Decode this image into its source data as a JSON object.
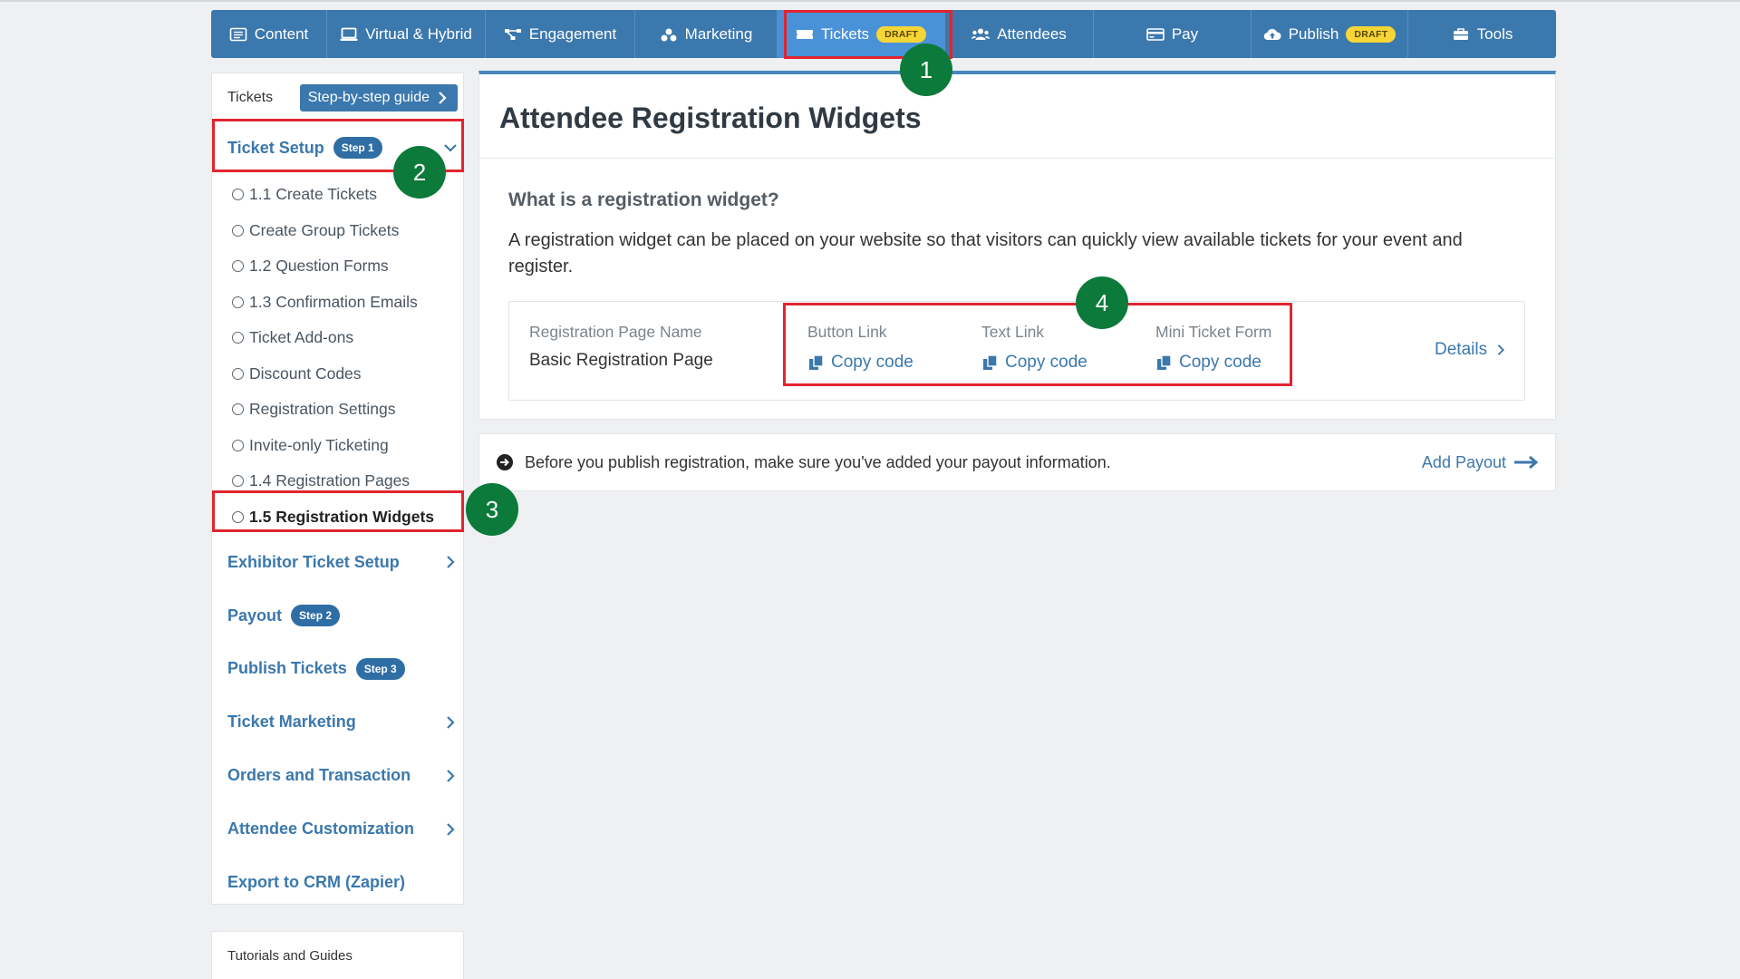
{
  "nav": {
    "items": [
      {
        "label": "Content",
        "icon": "list-icon"
      },
      {
        "label": "Virtual & Hybrid",
        "icon": "monitor-icon"
      },
      {
        "label": "Engagement",
        "icon": "network-icon"
      },
      {
        "label": "Marketing",
        "icon": "share-icon"
      },
      {
        "label": "Tickets",
        "icon": "ticket-icon",
        "badge": "DRAFT",
        "active": true
      },
      {
        "label": "Attendees",
        "icon": "users-icon"
      },
      {
        "label": "Pay",
        "icon": "credit-card-icon"
      },
      {
        "label": "Publish",
        "icon": "cloud-upload-icon",
        "badge": "DRAFT"
      },
      {
        "label": "Tools",
        "icon": "toolbox-icon"
      }
    ]
  },
  "sidebar": {
    "title": "Tickets",
    "guide_label": "Step-by-step guide",
    "ticket_setup": {
      "label": "Ticket Setup",
      "badge": "Step 1",
      "expanded": true
    },
    "sub_items": [
      "1.1 Create Tickets",
      "Create Group Tickets",
      "1.2 Question Forms",
      "1.3 Confirmation Emails",
      "Ticket Add-ons",
      "Discount Codes",
      "Registration Settings",
      "Invite-only Ticketing",
      "1.4 Registration Pages",
      "1.5 Registration Widgets"
    ],
    "current_sub_item": "1.5 Registration Widgets",
    "sections": [
      {
        "label": "Exhibitor Ticket Setup",
        "chevron": true
      },
      {
        "label": "Payout",
        "badge": "Step 2"
      },
      {
        "label": "Publish Tickets",
        "badge": "Step 3"
      },
      {
        "label": "Ticket Marketing",
        "chevron": true
      },
      {
        "label": "Orders and Transaction",
        "chevron": true
      },
      {
        "label": "Attendee Customization",
        "chevron": true
      },
      {
        "label": "Export to CRM (Zapier)"
      }
    ],
    "tutorials_label": "Tutorials and Guides"
  },
  "main": {
    "title": "Attendee Registration Widgets",
    "intro_heading": "What is a registration widget?",
    "intro_text": "A registration widget can be placed on your website so that visitors can quickly view available tickets for your event and register.",
    "widget": {
      "page_name_label": "Registration Page Name",
      "page_name_value": "Basic Registration Page",
      "button_link_label": "Button Link",
      "text_link_label": "Text Link",
      "mini_form_label": "Mini Ticket Form",
      "copy_label": "Copy code",
      "details_label": "Details"
    }
  },
  "notice": {
    "text": "Before you publish registration, make sure you've added your payout information.",
    "link_label": "Add Payout"
  },
  "annotations": {
    "markers": [
      "1",
      "2",
      "3",
      "4"
    ],
    "highlight_color": "#e02530",
    "marker_color": "#0b7a3a"
  },
  "colors": {
    "nav_bg": "#3b78ad",
    "nav_active": "#4a92d8",
    "link": "#3b78ad",
    "draft_badge": "#f6d636"
  }
}
